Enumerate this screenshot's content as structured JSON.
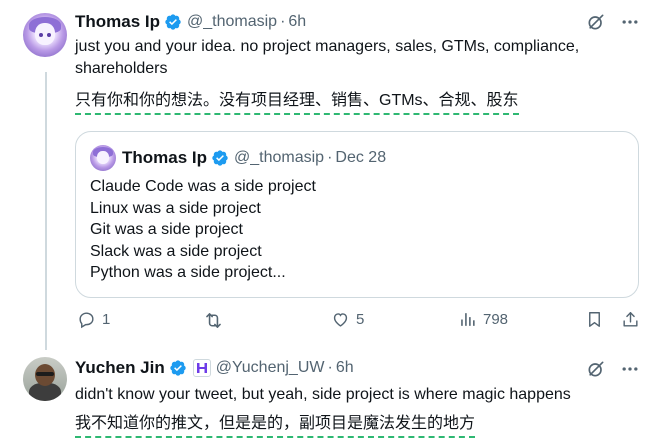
{
  "tweet1": {
    "name": "Thomas Ip",
    "handle": "@_thomasip",
    "separator": "·",
    "time": "6h",
    "text_line1": "just you and your idea. no project managers, sales, GTMs, compliance,",
    "text_line2": "shareholders",
    "translation": "只有你和你的想法。没有项目经理、销售、GTMs、合规、股东",
    "quote": {
      "name": "Thomas Ip",
      "handle": "@_thomasip",
      "separator": "·",
      "date": "Dec 28",
      "lines": [
        "Claude Code was a side project",
        "Linux was a side project",
        "Git was a side project",
        "Slack was a side project",
        "Python was a side project..."
      ]
    },
    "actions": {
      "replies": "1",
      "retweets": "",
      "likes": "5",
      "views": "798"
    }
  },
  "tweet2": {
    "name": "Yuchen Jin",
    "handle": "@Yuchenj_UW",
    "separator": "·",
    "time": "6h",
    "text": "didn't know your tweet, but yeah, side project is where magic happens",
    "translation": "我不知道你的推文，但是是的，副项目是魔法发生的地方"
  },
  "colors": {
    "verified": "#1d9bf0",
    "muted": "#536471",
    "border": "#cfd9de",
    "translation_underline": "#2eb872"
  },
  "icons": [
    "verified-badge-icon",
    "grok-icon",
    "more-icon",
    "reply-icon",
    "retweet-icon",
    "like-icon",
    "views-icon",
    "bookmark-icon",
    "share-icon",
    "affiliate-badge-icon"
  ]
}
